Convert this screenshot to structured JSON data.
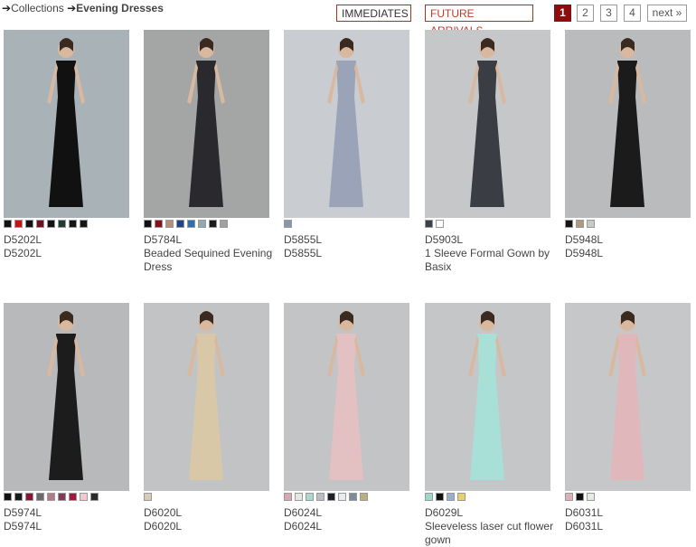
{
  "breadcrumb": {
    "parent": "Collections",
    "current": "Evening Dresses"
  },
  "filters": {
    "immediates": "IMMEDIATES",
    "future": "FUTURE ARRIVALS"
  },
  "pagination": {
    "pages": [
      "1",
      "2",
      "3",
      "4"
    ],
    "active": "1",
    "next": "next »"
  },
  "colors": {
    "accent": "#8b0d0d",
    "filter_border": "#9a3a1c",
    "future_text": "#c0392b"
  },
  "products": [
    {
      "code": "D5202L",
      "name": "D5202L",
      "dress": "#111111",
      "bg": "#a9b2b6",
      "swatches": [
        "#111111",
        "#c01818",
        "#121212",
        "#6e1020",
        "#131313",
        "#223a33",
        "#161616",
        "#161616"
      ]
    },
    {
      "code": "D5784L",
      "name": "Beaded Sequined Evening Dress",
      "dress": "#2a2a2e",
      "bg": "#a4a6a6",
      "swatches": [
        "#111111",
        "#8a0f1a",
        "#b48e7e",
        "#24428a",
        "#2d6fb0",
        "#8fa9b0",
        "#1c1c1c",
        "#9fa0a2"
      ]
    },
    {
      "code": "D5855L",
      "name": "D5855L",
      "dress": "#9aa3b8",
      "bg": "#c9ccd0",
      "swatches": [
        "#8a96b0"
      ]
    },
    {
      "code": "D5903L",
      "name": "1 Sleeve Formal Gown by Basix",
      "dress": "#3a3d44",
      "bg": "#c5c7c9",
      "swatches": [
        "#3c4048",
        "#ffffff"
      ]
    },
    {
      "code": "D5948L",
      "name": "D5948L",
      "dress": "#1b1b1b",
      "bg": "#b9bbbd",
      "swatches": [
        "#151515",
        "#b09a7c",
        "#c8c8c8"
      ]
    },
    {
      "code": "D5974L",
      "name": "D5974L",
      "dress": "#1c1c1c",
      "bg": "#b8b9bb",
      "swatches": [
        "#111111",
        "#1a1a1a",
        "#8a1530",
        "#6a6a6a",
        "#b57a8a",
        "#7b3e56",
        "#a31838",
        "#f0c8d0",
        "#2a2a2a"
      ]
    },
    {
      "code": "D6020L",
      "name": "D6020L",
      "dress": "#d8c8a8",
      "bg": "#c2c3c4",
      "swatches": [
        "#d6ccb6"
      ]
    },
    {
      "code": "D6024L",
      "name": "D6024L",
      "dress": "#e3c0c2",
      "bg": "#c3c4c6",
      "swatches": [
        "#d8a8ae",
        "#e6e6e6",
        "#a8d8d0",
        "#b8bcc4",
        "#1e2028",
        "#e8ecec",
        "#7b8c9a",
        "#b8b080"
      ]
    },
    {
      "code": "D6029L",
      "name": "Sleeveless laser cut flower gown",
      "dress": "#a8e0d8",
      "bg": "#c5c6c8",
      "swatches": [
        "#9ad8cc",
        "#111111",
        "#9ab0c8",
        "#e6d070"
      ]
    },
    {
      "code": "D6031L",
      "name": "D6031L",
      "dress": "#e0b8bc",
      "bg": "#c6c7c9",
      "swatches": [
        "#dcb0b4",
        "#111111",
        "#e0ece4"
      ]
    }
  ]
}
